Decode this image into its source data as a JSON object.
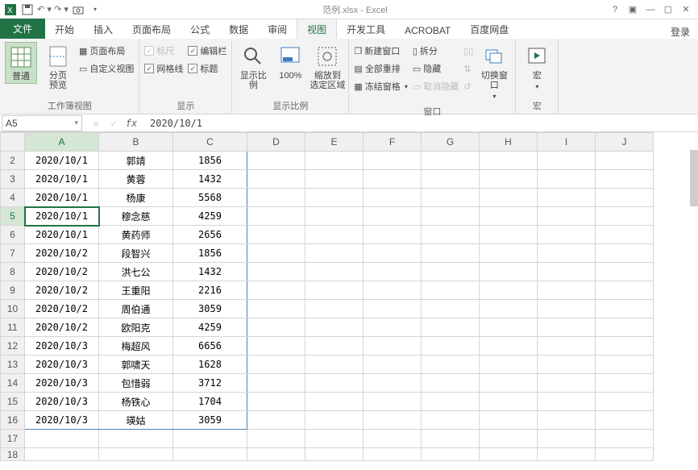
{
  "titlebar": {
    "title": "范例.xlsx - Excel",
    "help": "?",
    "restore": "▣",
    "minimize": "—",
    "close": "✕"
  },
  "tabs": {
    "file": "文件",
    "items": [
      "开始",
      "插入",
      "页面布局",
      "公式",
      "数据",
      "审阅",
      "视图",
      "开发工具",
      "ACROBAT",
      "百度网盘"
    ],
    "active_index": 6,
    "login": "登录"
  },
  "ribbon": {
    "group1": {
      "label": "工作簿视图",
      "normal": "普通",
      "preview": "分页\n预览",
      "page_layout": "页面布局",
      "custom_view": "自定义视图"
    },
    "group2": {
      "label": "显示",
      "ruler": "标尺",
      "formula_bar": "编辑栏",
      "gridlines": "网格线",
      "headings": "标题"
    },
    "group3": {
      "label": "显示比例",
      "zoom": "显示比例",
      "hundred": "100%",
      "fit": "缩放到\n选定区域"
    },
    "group4": {
      "label": "窗口",
      "new_window": "新建窗口",
      "arrange_all": "全部重排",
      "freeze": "冻结窗格",
      "split": "拆分",
      "hide": "隐藏",
      "unhide": "取消隐藏",
      "switch": "切换窗口"
    },
    "group5": {
      "label": "宏",
      "macro": "宏"
    }
  },
  "namebox": {
    "ref": "A5"
  },
  "formula": {
    "value": "2020/10/1"
  },
  "columns": [
    "A",
    "B",
    "C",
    "D",
    "E",
    "F",
    "G",
    "H",
    "I",
    "J"
  ],
  "rows": [
    {
      "n": 2,
      "a": "2020/10/1",
      "b": "郭靖",
      "c": "1856"
    },
    {
      "n": 3,
      "a": "2020/10/1",
      "b": "黄蓉",
      "c": "1432"
    },
    {
      "n": 4,
      "a": "2020/10/1",
      "b": "杨康",
      "c": "5568"
    },
    {
      "n": 5,
      "a": "2020/10/1",
      "b": "穆念慈",
      "c": "4259"
    },
    {
      "n": 6,
      "a": "2020/10/1",
      "b": "黄药师",
      "c": "2656"
    },
    {
      "n": 7,
      "a": "2020/10/2",
      "b": "段智兴",
      "c": "1856"
    },
    {
      "n": 8,
      "a": "2020/10/2",
      "b": "洪七公",
      "c": "1432"
    },
    {
      "n": 9,
      "a": "2020/10/2",
      "b": "王重阳",
      "c": "2216"
    },
    {
      "n": 10,
      "a": "2020/10/2",
      "b": "周伯通",
      "c": "3059"
    },
    {
      "n": 11,
      "a": "2020/10/2",
      "b": "欧阳克",
      "c": "4259"
    },
    {
      "n": 12,
      "a": "2020/10/3",
      "b": "梅超风",
      "c": "6656"
    },
    {
      "n": 13,
      "a": "2020/10/3",
      "b": "郭啸天",
      "c": "1628"
    },
    {
      "n": 14,
      "a": "2020/10/3",
      "b": "包惜弱",
      "c": "3712"
    },
    {
      "n": 15,
      "a": "2020/10/3",
      "b": "杨铁心",
      "c": "1704"
    },
    {
      "n": 16,
      "a": "2020/10/3",
      "b": "瑛姑",
      "c": "3059"
    }
  ],
  "empty_rows": [
    17,
    18
  ]
}
